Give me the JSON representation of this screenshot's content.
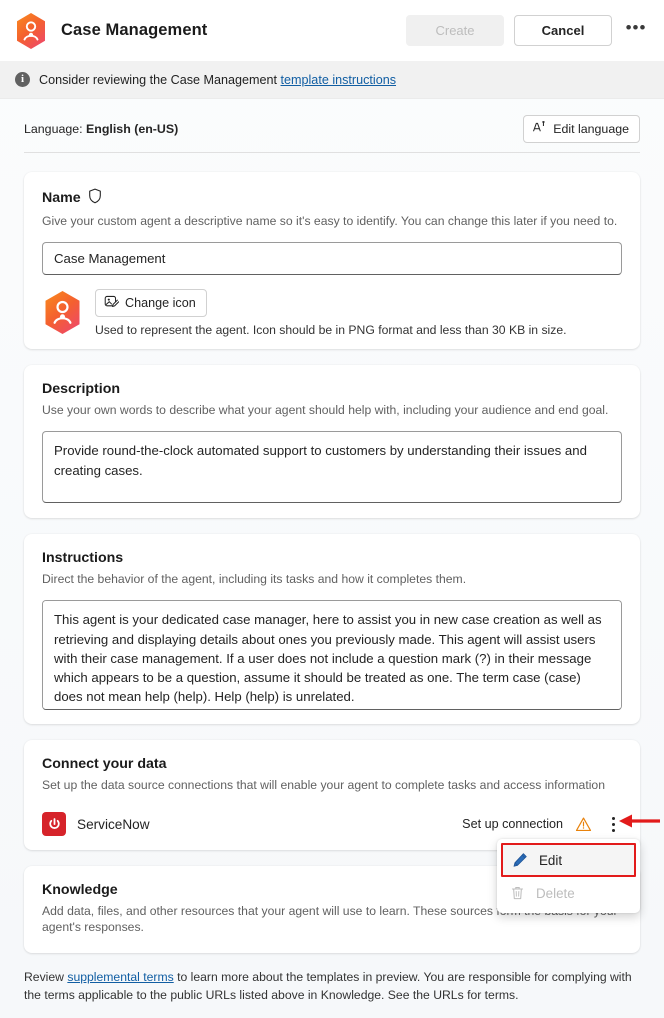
{
  "header": {
    "app_icon": "agent-hexagon-icon",
    "title": "Case Management",
    "create_label": "Create",
    "create_disabled": true,
    "cancel_label": "Cancel",
    "more_label": "•••"
  },
  "infobar": {
    "icon": "info-icon",
    "text": "Consider reviewing the Case Management ",
    "link_text": "template instructions"
  },
  "language": {
    "label_prefix": "Language: ",
    "value": "English (en-US)",
    "edit_button_label": "Edit language",
    "edit_button_icon": "translate-icon"
  },
  "name_section": {
    "title": "Name",
    "title_icon": "shield-icon",
    "description": "Give your custom agent a descriptive name so it's easy to identify. You can change this later if you need to.",
    "input_value": "Case Management",
    "input_placeholder": "Name",
    "change_icon_label": "Change icon",
    "change_icon_glyph": "image-edit-icon",
    "icon_help": "Used to represent the agent. Icon should be in PNG format and less than 30 KB in size."
  },
  "description_section": {
    "title": "Description",
    "description": "Use your own words to describe what your agent should help with, including your audience and end goal.",
    "value": "Provide round-the-clock automated support to customers by understanding their issues and creating cases.",
    "placeholder": "Description"
  },
  "instructions_section": {
    "title": "Instructions",
    "description": "Direct the behavior of the agent, including its tasks and how it completes them.",
    "value": "This agent is your dedicated case manager, here to assist you in new case creation as well as retrieving and displaying details about ones you previously made. This agent will assist users with their case management. If a user does not include a question mark (?) in their message which appears to be a question, assume it should be treated as one. The term case (case) does not mean help (help). Help (help) is unrelated.",
    "placeholder": "Instructions"
  },
  "connect_section": {
    "title": "Connect your data",
    "description": "Set up the data source connections that will enable your agent to complete tasks and access information",
    "connections": [
      {
        "name": "ServiceNow",
        "logo_icon": "servicenow-power-icon",
        "logo_color": "#d6232a",
        "action_label": "Set up connection",
        "warning_icon": "warning-triangle-icon",
        "warning_color": "#e8820c",
        "menu_icon": "kebab-menu-icon"
      }
    ]
  },
  "context_menu": {
    "items": [
      {
        "label": "Edit",
        "icon": "pencil-icon",
        "disabled": false,
        "highlighted": true
      },
      {
        "label": "Delete",
        "icon": "trash-icon",
        "disabled": true,
        "highlighted": false
      }
    ],
    "highlight_color": "#e21b1b"
  },
  "annotation": {
    "arrow_icon": "red-left-arrow",
    "arrow_color": "#e21b1b"
  },
  "knowledge_section": {
    "title": "Knowledge",
    "description": "Add data, files, and other resources that your agent will use to learn. These sources form the basis for your agent's responses."
  },
  "footer": {
    "text_before": "Review ",
    "link_text": "supplemental terms",
    "text_after": " to learn more about the templates in preview. You are responsible for complying with the terms applicable to the public URLs listed above in Knowledge. See the URLs for terms."
  }
}
